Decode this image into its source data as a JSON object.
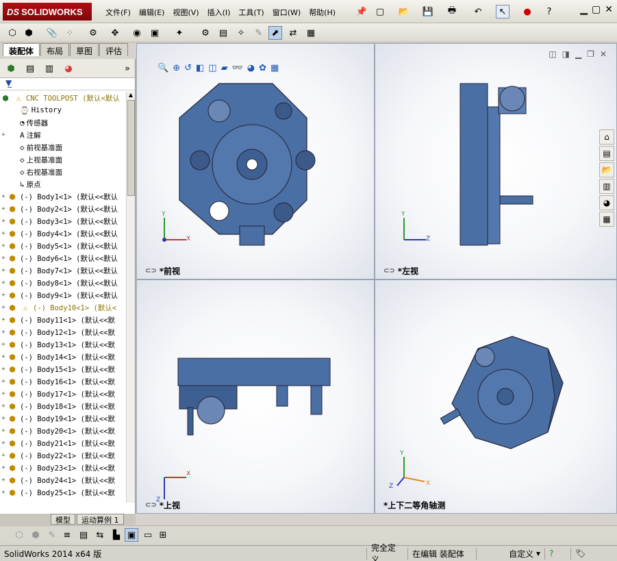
{
  "app": {
    "logo_mark": "DS",
    "logo_text": "SOLIDWORKS"
  },
  "menu": [
    "文件(F)",
    "编辑(E)",
    "视图(V)",
    "插入(I)",
    "工具(T)",
    "窗口(W)",
    "帮助(H)"
  ],
  "help_glyph": "?",
  "cm_tabs": [
    "装配体",
    "布局",
    "草图",
    "评估"
  ],
  "tree": {
    "root": "CNC TOOLPOST  (默认<默认",
    "items": [
      {
        "label": "History",
        "icon": "history-icon"
      },
      {
        "label": "传感器",
        "icon": "sensor-icon"
      },
      {
        "label": "注解",
        "icon": "annotation-icon",
        "expand": "+"
      },
      {
        "label": "前视基准面",
        "icon": "plane-icon"
      },
      {
        "label": "上视基准面",
        "icon": "plane-icon"
      },
      {
        "label": "右视基准面",
        "icon": "plane-icon"
      },
      {
        "label": "原点",
        "icon": "origin-icon"
      }
    ],
    "bodies": [
      "(-) Body1<1> (默认<<默认",
      "(-) Body2<1> (默认<<默认",
      "(-) Body3<1> (默认<<默认",
      "(-) Body4<1> (默认<<默认",
      "(-) Body5<1> (默认<<默认",
      "(-) Body6<1> (默认<<默认",
      "(-) Body7<1> (默认<<默认",
      "(-) Body8<1> (默认<<默认",
      "(-) Body9<1> (默认<<默认",
      "(-) Body10<1> (默认<",
      "(-) Body11<1> (默认<<默",
      "(-) Body12<1> (默认<<默",
      "(-) Body13<1> (默认<<默",
      "(-) Body14<1> (默认<<默",
      "(-) Body15<1> (默认<<默",
      "(-) Body16<1> (默认<<默",
      "(-) Body17<1> (默认<<默",
      "(-) Body18<1> (默认<<默",
      "(-) Body19<1> (默认<<默",
      "(-) Body20<1> (默认<<默",
      "(-) Body21<1> (默认<<默",
      "(-) Body22<1> (默认<<默",
      "(-) Body23<1> (默认<<默",
      "(-) Body24<1> (默认<<默",
      "(-) Body25<1> (默认<<默"
    ],
    "warning_body_index": 9
  },
  "bottom_tabs": [
    "模型",
    "运动算例 1"
  ],
  "views": {
    "front": "*前视",
    "left": "*左视",
    "top": "*上视",
    "iso": "*上下二等角轴测"
  },
  "triad": {
    "x": "X",
    "y": "Y",
    "z": "Z"
  },
  "status": {
    "app": "SolidWorks 2014 x64 版",
    "defined": "完全定义",
    "editing": "在编辑 装配体",
    "units": "自定义"
  },
  "colors": {
    "part": "#4a6fa5",
    "accent": "#b00f14"
  }
}
